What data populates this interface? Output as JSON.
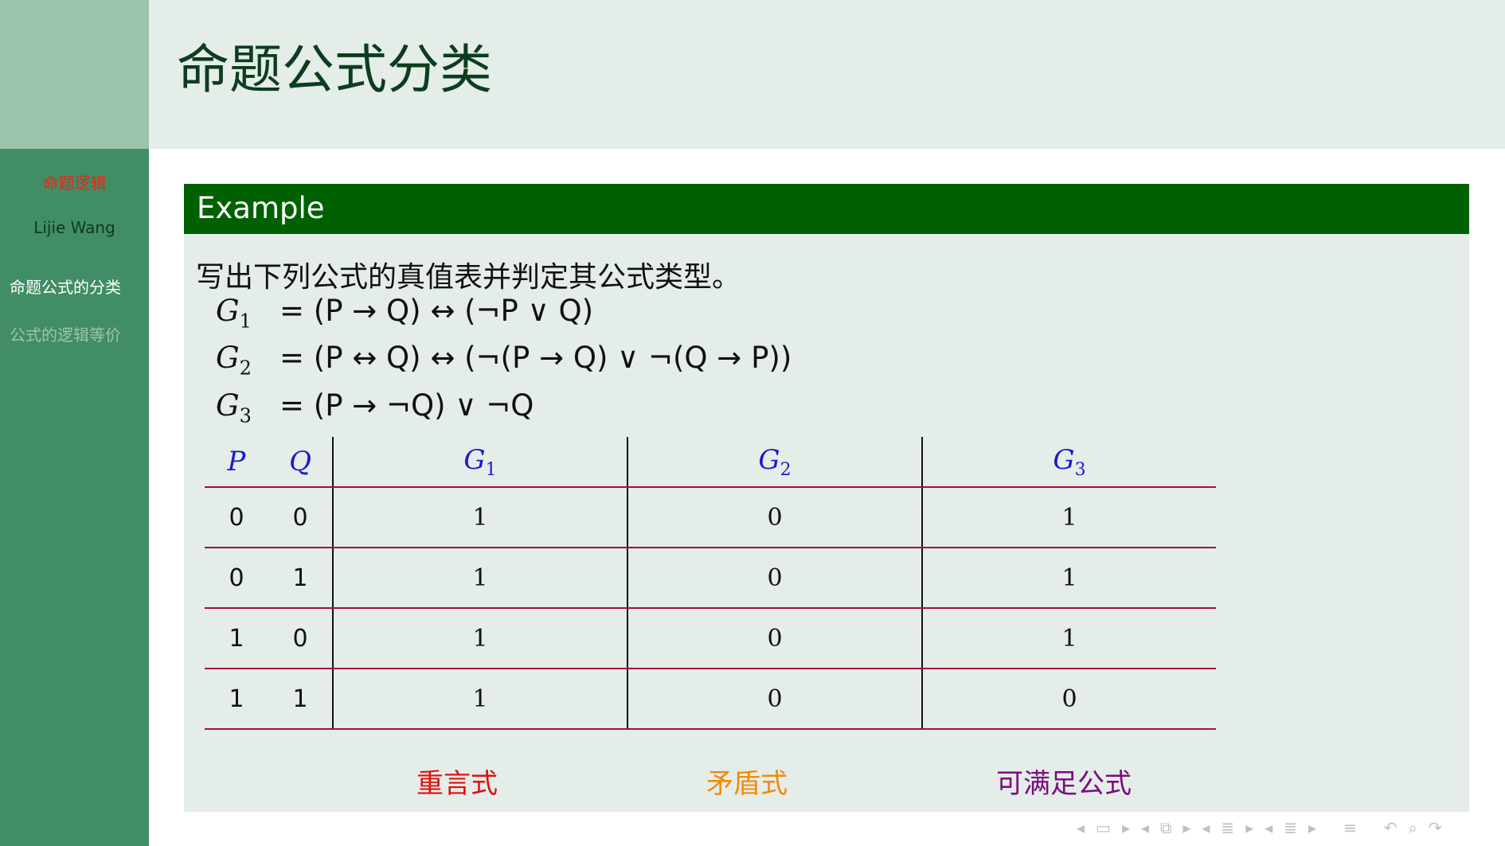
{
  "sidebar": {
    "title": "命题逻辑",
    "author": "Lijie Wang",
    "sections": [
      "命题公式的分类",
      "公式的逻辑等价"
    ]
  },
  "frame": {
    "title": "命题公式分类"
  },
  "block": {
    "title": "Example",
    "intro": "写出下列公式的真值表并判定其公式类型。",
    "equations": [
      {
        "lhs": "G",
        "sub": "1",
        "rhs": "= (P → Q) ↔ (¬P ∨ Q)"
      },
      {
        "lhs": "G",
        "sub": "2",
        "rhs": "= (P ↔ Q) ↔ (¬(P → Q) ∨ ¬(Q → P))"
      },
      {
        "lhs": "G",
        "sub": "3",
        "rhs": "= (P → ¬Q) ∨ ¬Q"
      }
    ],
    "table": {
      "headers": [
        "P",
        "Q",
        "G",
        "1",
        "G",
        "2",
        "G",
        "3"
      ],
      "rows": [
        [
          "0",
          "0",
          "1",
          "0",
          "1"
        ],
        [
          "0",
          "1",
          "1",
          "0",
          "1"
        ],
        [
          "1",
          "0",
          "1",
          "0",
          "1"
        ],
        [
          "1",
          "1",
          "1",
          "0",
          "0"
        ]
      ]
    },
    "types": [
      "重言式",
      "矛盾式",
      "可满足公式"
    ]
  },
  "colors": {
    "sidebar": "#418d66",
    "block_header": "#006102",
    "tautology": "#de1010",
    "contradiction": "#f08a0a",
    "satisfiable": "#7b0a80"
  },
  "nav_icons": [
    "nav-prev-icon",
    "frame-icon",
    "nav-next-icon",
    "nav-prev-icon",
    "subsection-icon",
    "nav-next-icon",
    "nav-prev-icon",
    "section-icon",
    "nav-next-icon",
    "nav-prev-icon",
    "document-icon",
    "nav-next-icon",
    "toc-icon",
    "back-icon",
    "search-icon",
    "forward-icon"
  ]
}
